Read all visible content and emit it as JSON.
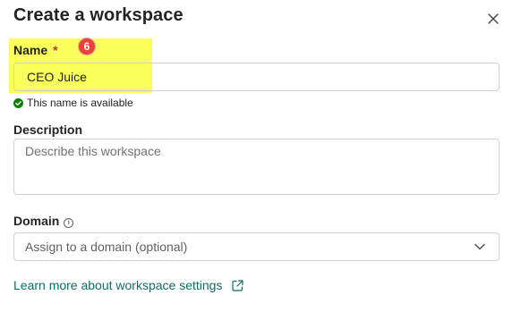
{
  "dialog": {
    "title": "Create a workspace",
    "close_icon": "close-icon"
  },
  "name_field": {
    "label": "Name",
    "required_marker": "*",
    "badge": "6",
    "value": "CEO Juice",
    "validation": "This name is available",
    "validation_icon": "check-circle-icon"
  },
  "description_field": {
    "label": "Description",
    "placeholder": "Describe this workspace"
  },
  "domain_field": {
    "label": "Domain",
    "info_icon": "info-icon",
    "placeholder": "Assign to a domain (optional)",
    "dropdown_icon": "chevron-down-icon"
  },
  "learn_more": {
    "label": "Learn more about workspace settings",
    "icon": "external-link-icon"
  },
  "colors": {
    "highlight": "#fbff5c",
    "badge": "#e8433a",
    "link": "#0f6d64",
    "success": "#107c10",
    "required": "#c4314b"
  }
}
